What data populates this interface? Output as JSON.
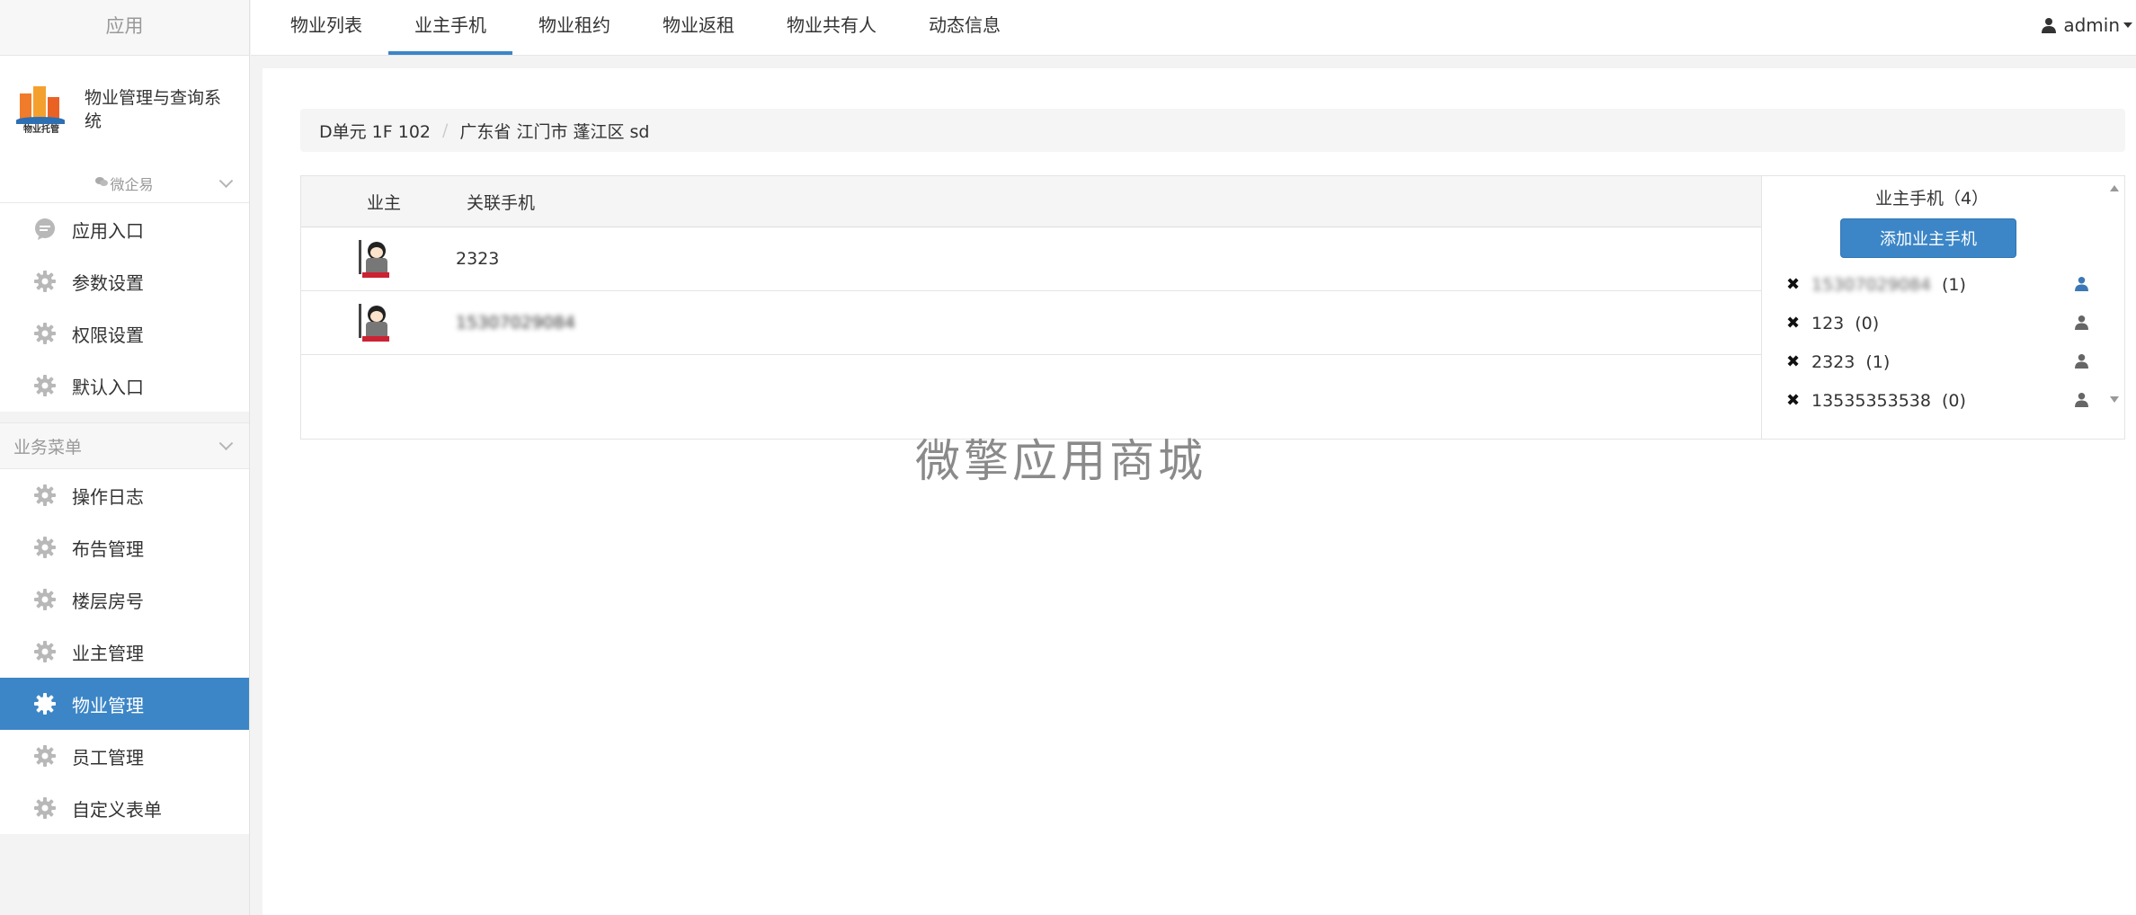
{
  "sidebar": {
    "app_title": "应用",
    "brand_name": "物业管理与查询系统",
    "logo_text": "物业托管",
    "sub_link": "微企易",
    "top_items": [
      {
        "label": "应用入口",
        "icon": "chat-bubble-icon"
      },
      {
        "label": "参数设置",
        "icon": "gear-icon"
      },
      {
        "label": "权限设置",
        "icon": "gear-icon"
      },
      {
        "label": "默认入口",
        "icon": "gear-icon"
      }
    ],
    "section_title": "业务菜单",
    "section_items": [
      {
        "label": "操作日志",
        "icon": "gear-icon"
      },
      {
        "label": "布告管理",
        "icon": "gear-icon"
      },
      {
        "label": "楼层房号",
        "icon": "gear-icon"
      },
      {
        "label": "业主管理",
        "icon": "gear-icon"
      },
      {
        "label": "物业管理",
        "icon": "gear-icon",
        "active": true
      },
      {
        "label": "员工管理",
        "icon": "gear-icon"
      },
      {
        "label": "自定义表单",
        "icon": "gear-icon"
      }
    ]
  },
  "topnav": {
    "tabs": [
      "物业列表",
      "业主手机",
      "物业租约",
      "物业返租",
      "物业共有人",
      "动态信息"
    ],
    "active_tab": "业主手机",
    "user": "admin"
  },
  "breadcrumb": {
    "unit": "D单元 1F 102",
    "address": "广东省 江门市 蓬江区 sd"
  },
  "owners_table": {
    "headers": {
      "owner": "业主",
      "phone": "关联手机"
    },
    "rows": [
      {
        "phone": "2323",
        "blurred": false
      },
      {
        "phone": "15307029084",
        "blurred": true
      }
    ]
  },
  "phones_panel": {
    "title": "业主手机（4）",
    "add_button": "添加业主手机",
    "items": [
      {
        "number": "15307029084",
        "count": "(1)",
        "blurred": true,
        "icon_color": "#3c78b5"
      },
      {
        "number": "123",
        "count": "(0)",
        "blurred": false,
        "icon_color": "#666666"
      },
      {
        "number": "2323",
        "count": "(1)",
        "blurred": false,
        "icon_color": "#666666"
      },
      {
        "number": "13535353538",
        "count": "(0)",
        "blurred": false,
        "icon_color": "#666666"
      }
    ]
  },
  "watermark": "微擎应用商城",
  "colors": {
    "accent": "#3c86c7",
    "active_menu": "#3c86c7"
  }
}
